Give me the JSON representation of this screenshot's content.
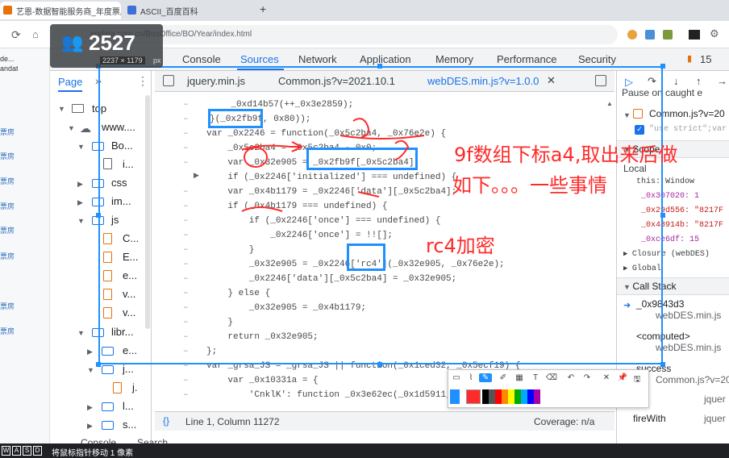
{
  "browser": {
    "tabs": [
      {
        "label": "艺恩-数据智能服务商_年度票房",
        "active": true
      },
      {
        "label": "ASCII_百度百科",
        "active": false
      }
    ],
    "new_tab": "+",
    "url": "endata.com.cn/BoxOffice/BO/Year/index.html"
  },
  "overlay": {
    "user_count": "2527",
    "size_readout": "2237 × 1179",
    "size_unit": "px"
  },
  "left_strip": {
    "items": [
      "de...",
      "andata",
      "票房",
      "票房",
      "票房",
      "票房",
      "票房",
      "票房",
      "票房",
      "票房"
    ]
  },
  "devtools": {
    "tabs": [
      "Console",
      "Sources",
      "Network",
      "Application",
      "Memory",
      "Performance",
      "Security"
    ],
    "active_tab": "Sources",
    "issue_count": "15",
    "navigator": {
      "tab": "Page",
      "tree": [
        {
          "label": "top",
          "depth": 0
        },
        {
          "label": "www....",
          "depth": 1
        },
        {
          "label": "Bo...",
          "depth": 2
        },
        {
          "label": "i...",
          "depth": 3
        },
        {
          "label": "css",
          "depth": 2
        },
        {
          "label": "im...",
          "depth": 2
        },
        {
          "label": "js",
          "depth": 2
        },
        {
          "label": "C...",
          "depth": 3
        },
        {
          "label": "E...",
          "depth": 3
        },
        {
          "label": "e...",
          "depth": 3
        },
        {
          "label": "v...",
          "depth": 3
        },
        {
          "label": "v...",
          "depth": 3
        },
        {
          "label": "libr...",
          "depth": 2
        },
        {
          "label": "e...",
          "depth": 3
        },
        {
          "label": "j...",
          "depth": 3
        },
        {
          "label": "j.",
          "depth": 4
        },
        {
          "label": "l...",
          "depth": 3
        },
        {
          "label": "s...",
          "depth": 3
        }
      ]
    },
    "editor_tabs": [
      {
        "label": "jquery.min.js",
        "active": false
      },
      {
        "label": "Common.js?v=2021.10.1",
        "active": false
      },
      {
        "label": "webDES.min.js?v=1.0.0",
        "active": true
      }
    ],
    "code_lines": [
      "    _0xd14b57(++_0x3e2859);",
      "}(_0x2fb9f, 0x80));",
      "var _0x2246 = function(_0x5c2ba4, _0x76e2e) {",
      "    _0x5c2ba4 = _0x5c2ba4 - 0x0;",
      "    var _0x32e905 = _0x2fb9f[_0x5c2ba4];",
      "    if (_0x2246['initialized'] === undefined) {",
      "    var _0x4b1179 = _0x2246['data'][_0x5c2ba4];",
      "    if (_0x4b1179 === undefined) {",
      "        if (_0x2246['once'] === undefined) {",
      "            _0x2246['once'] = !![];",
      "        }",
      "        _0x32e905 = _0x2246['rc4'](_0x32e905, _0x76e2e);",
      "        _0x2246['data'][_0x5c2ba4] = _0x32e905;",
      "    } else {",
      "        _0x32e905 = _0x4b1179;",
      "    }",
      "    return _0x32e905;",
      "};",
      "var _grsa_JS = _grsa_JS || function(_0x1ced32, _0x5ecf19) {",
      "    var _0x10331a = {",
      "        'CnklK': function _0x3e62ec(_0x1d5911,"
    ],
    "status": {
      "position": "Line 1, Column 11272",
      "coverage": "Coverage: n/a"
    },
    "right_panel": {
      "pause_label": "Pause on caught e",
      "breakpoint": "Common.js?v=20",
      "breakpoint_code": "\"use strict\";var",
      "scope_label": "Scope",
      "local_label": "Local",
      "scope_vars": [
        "this: Window",
        "_0x307020: 1",
        "_0x29d556: \"8217F",
        "_0x48914b: \"8217F",
        "_0xce6df: 15"
      ],
      "closure": "Closure (webDES)",
      "global": "Global",
      "call_stack_label": "Call Stack",
      "frames": [
        {
          "fn": "_0x9843d3",
          "file": "webDES.min.js"
        },
        {
          "fn": "<computed>",
          "file": "webDES.min.js"
        },
        {
          "fn": "success",
          "file": "Common.js?v=20"
        },
        {
          "fn": "i",
          "file": "jquer"
        },
        {
          "fn": "fireWith",
          "file": "jquer"
        }
      ]
    },
    "drawer": [
      "Console",
      "Search"
    ]
  },
  "annotations": {
    "note1": "9f数组下标a4,取出来后做",
    "note2": "如下。。。一些事情",
    "note3": "rc4加密",
    "colors": {
      "box": "#1e90ff",
      "ink": "#ff2a2a"
    }
  },
  "bottom": {
    "keys": [
      "W",
      "A",
      "S",
      "D"
    ],
    "hint": "将鼠标指针移动 1 像素"
  }
}
